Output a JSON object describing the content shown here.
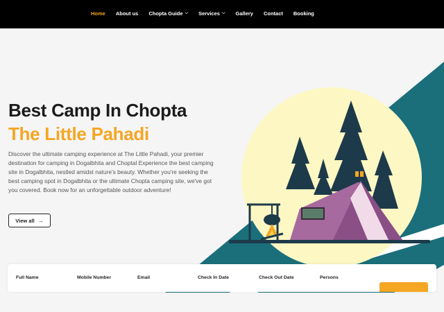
{
  "nav": {
    "items": [
      {
        "label": "Home",
        "active": true,
        "has_dropdown": false
      },
      {
        "label": "About us",
        "active": false,
        "has_dropdown": false
      },
      {
        "label": "Chopta Guide",
        "active": false,
        "has_dropdown": true
      },
      {
        "label": "Services",
        "active": false,
        "has_dropdown": true
      },
      {
        "label": "Gallery",
        "active": false,
        "has_dropdown": false
      },
      {
        "label": "Contact",
        "active": false,
        "has_dropdown": false
      },
      {
        "label": "Booking",
        "active": false,
        "has_dropdown": false
      }
    ],
    "dropdown_icon": "chevron-down-icon"
  },
  "hero": {
    "title_line1": "Best Camp In Chopta",
    "title_line2": "The Little Pahadi",
    "description": "Discover the ultimate camping experience at The Little Pahadi, your premier destination for camping in Dogalbhita and Choptal Experience the best camping site in Dogalbhita, nestled amidst nature's beauty. Whether you're seeking the best camping spot in Dogalbhita or the ultimate Chopta camping site, we've got you covered. Book now for an unforgettable outdoor adventure!",
    "view_all_label": "View all",
    "view_all_icon": "arrow-right-icon"
  },
  "booking_form": {
    "fields": [
      "Full Name",
      "Mobile Number",
      "Email",
      "Check In Date",
      "Check Out Date",
      "Persons"
    ]
  },
  "colors": {
    "accent": "#f5a623",
    "teal": "#1b6f7b",
    "sun": "#fdf7c3",
    "tent": "#a66a9e",
    "tree": "#1d3a4a",
    "nav_bg": "#000000"
  }
}
